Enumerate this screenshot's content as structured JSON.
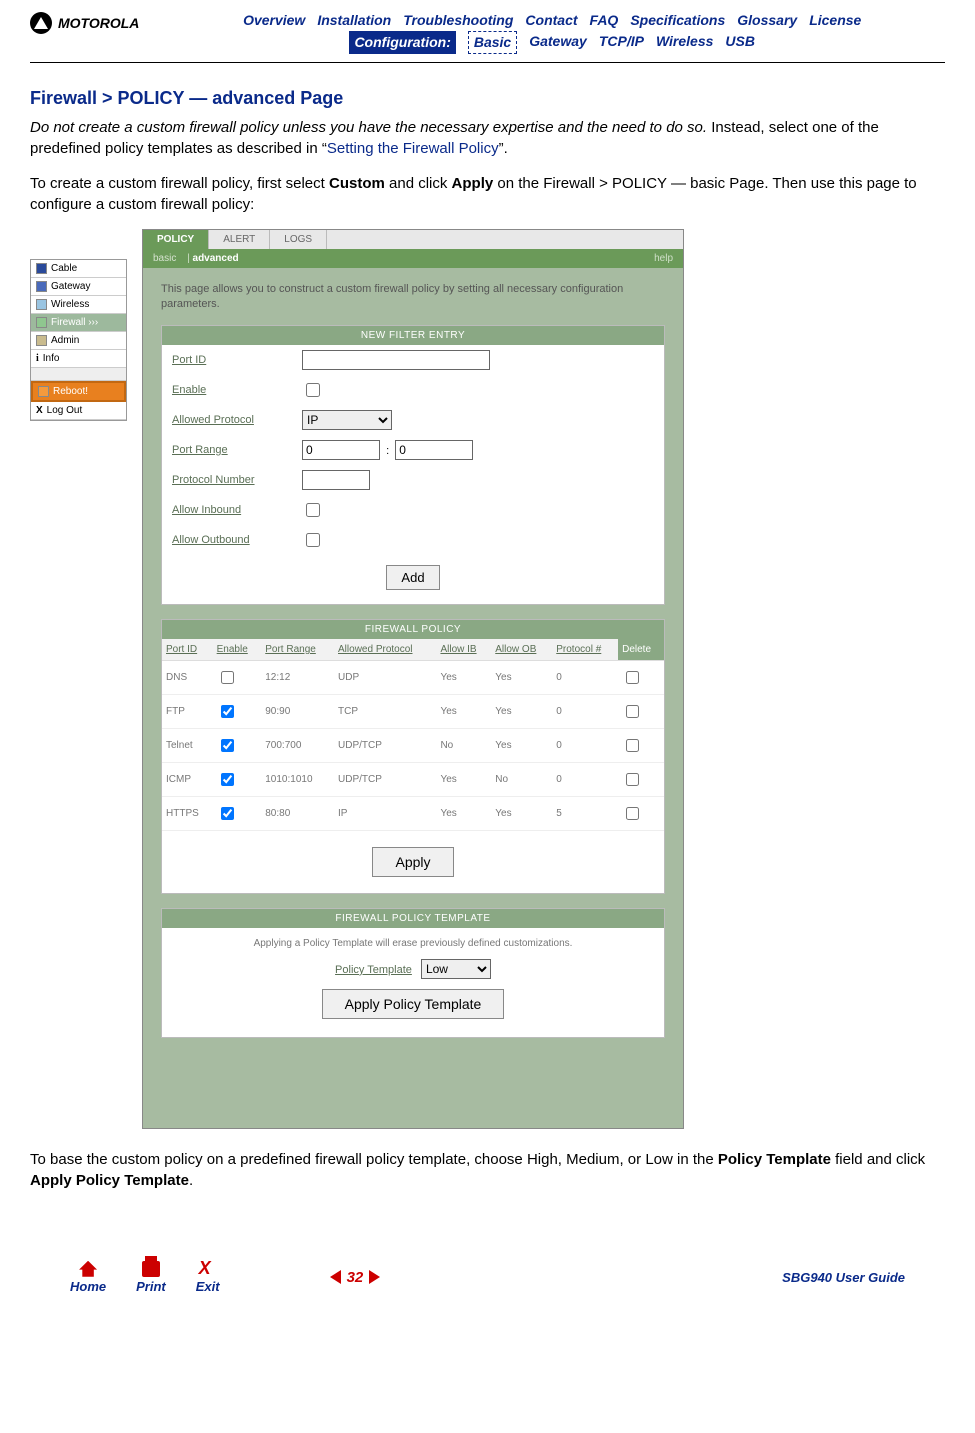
{
  "brand": "MOTOROLA",
  "topnav": {
    "row1": [
      "Overview",
      "Installation",
      "Troubleshooting",
      "Contact",
      "FAQ",
      "Specifications",
      "Glossary",
      "License"
    ],
    "config_label": "Configuration:",
    "row2": [
      "Basic",
      "Gateway",
      "TCP/IP",
      "Wireless",
      "USB"
    ],
    "dotted_index": 0
  },
  "title": "Firewall > POLICY — advanced Page",
  "para1_italic": "Do not create a custom firewall policy unless you have the necessary expertise and the need to do so. ",
  "para1_rest_a": "Instead, select one of the predefined policy templates as described in “",
  "para1_link": "Setting the Firewall Policy",
  "para1_rest_b": "”.",
  "para2_a": "To create a custom firewall policy, first select ",
  "para2_b1": "Custom",
  "para2_c": " and click ",
  "para2_b2": "Apply",
  "para2_d": " on the Firewall > POLICY — basic Page. Then use this page to configure a custom firewall policy:",
  "sidemenu": {
    "items": [
      "Cable",
      "Gateway",
      "Wireless",
      "Firewall",
      "Admin",
      "Info"
    ],
    "active_index": 3,
    "active_suffix": "  ›››",
    "reboot": "Reboot!",
    "logout": "Log Out"
  },
  "panel": {
    "tabs": [
      "POLICY",
      "ALERT",
      "LOGS"
    ],
    "active_tab": 0,
    "subtabs": [
      "basic",
      "advanced"
    ],
    "active_sub": 1,
    "help": "help",
    "desc": "This page allows you to construct a custom firewall policy by setting all necessary configuration parameters.",
    "new_filter": {
      "header": "NEW FILTER ENTRY",
      "fields": {
        "port_id": "Port ID",
        "enable": "Enable",
        "allowed_protocol": "Allowed Protocol",
        "port_range": "Port Range",
        "protocol_number": "Protocol Number",
        "allow_inbound": "Allow Inbound",
        "allow_outbound": "Allow Outbound"
      },
      "protocol_value": "IP",
      "port_from": "0",
      "port_to": "0",
      "add_btn": "Add"
    },
    "policy_table": {
      "header": "FIREWALL POLICY",
      "cols": [
        "Port ID",
        "Enable",
        "Port Range",
        "Allowed Protocol",
        "Allow IB",
        "Allow OB",
        "Protocol #",
        "Delete"
      ],
      "rows": [
        {
          "id": "DNS",
          "enable": false,
          "range": "12:12",
          "proto": "UDP",
          "ib": "Yes",
          "ob": "Yes",
          "num": "0"
        },
        {
          "id": "FTP",
          "enable": true,
          "range": "90:90",
          "proto": "TCP",
          "ib": "Yes",
          "ob": "Yes",
          "num": "0"
        },
        {
          "id": "Telnet",
          "enable": true,
          "range": "700:700",
          "proto": "UDP/TCP",
          "ib": "No",
          "ob": "Yes",
          "num": "0"
        },
        {
          "id": "ICMP",
          "enable": true,
          "range": "1010:1010",
          "proto": "UDP/TCP",
          "ib": "Yes",
          "ob": "No",
          "num": "0"
        },
        {
          "id": "HTTPS",
          "enable": true,
          "range": "80:80",
          "proto": "IP",
          "ib": "Yes",
          "ob": "Yes",
          "num": "5"
        }
      ],
      "apply_btn": "Apply"
    },
    "template": {
      "header": "FIREWALL POLICY TEMPLATE",
      "desc": "Applying a Policy Template will erase previously defined customizations.",
      "label": "Policy Template",
      "value": "Low",
      "btn": "Apply Policy Template"
    }
  },
  "para3_a": "To base the custom policy on a predefined firewall policy template, choose High, Medium, or Low in the ",
  "para3_b": "Policy Template",
  "para3_c": " field and click ",
  "para3_d": "Apply Policy Template",
  "para3_e": ".",
  "footer": {
    "home": "Home",
    "print": "Print",
    "exit": "Exit",
    "exit_x": "X",
    "page": "32",
    "guide": "SBG940 User Guide"
  }
}
